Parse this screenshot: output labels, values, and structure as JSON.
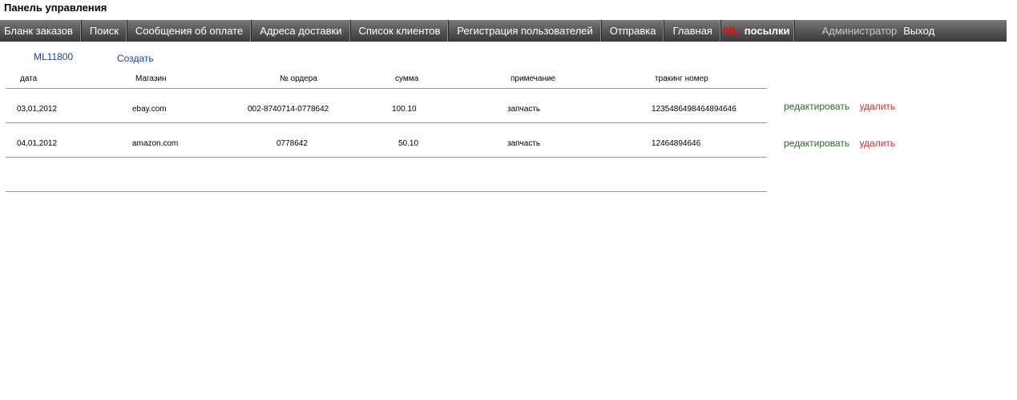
{
  "page": {
    "title": "Панель управления"
  },
  "nav": {
    "items": [
      "Бланк заказов",
      "Поиск",
      "Сообщения об оплате",
      "Адреса доставки",
      "Список клиентов",
      "Регистрация пользователей",
      "Отправка",
      "Главная"
    ],
    "ml_label": "ML",
    "parcels_label": "посылки",
    "admin_label": "Администратор",
    "logout_label": "Выход"
  },
  "account": {
    "id": "ML11800",
    "create_label": "Создать"
  },
  "table": {
    "headers": [
      "дата",
      "Магазин",
      "№ ордера",
      "сумма",
      "примечание",
      "тракинг номер"
    ],
    "rows": [
      [
        "03,01,2012",
        "ebay.com",
        "002-8740714-0778642",
        "100.10",
        "запчасть",
        "1235486498464894646"
      ],
      [
        "04,01,2012",
        "amazon.com",
        "0778642",
        "50.10",
        "запчасть",
        "12464894646"
      ]
    ],
    "edit_label": "редактировать",
    "delete_label": "удалить"
  },
  "colors": {
    "nav_bg": "#4a4a4a",
    "ml_red": "#e01010",
    "link_blue": "#1a3fae",
    "edit_green": "#2a6a2a",
    "delete_red": "#d03030"
  }
}
